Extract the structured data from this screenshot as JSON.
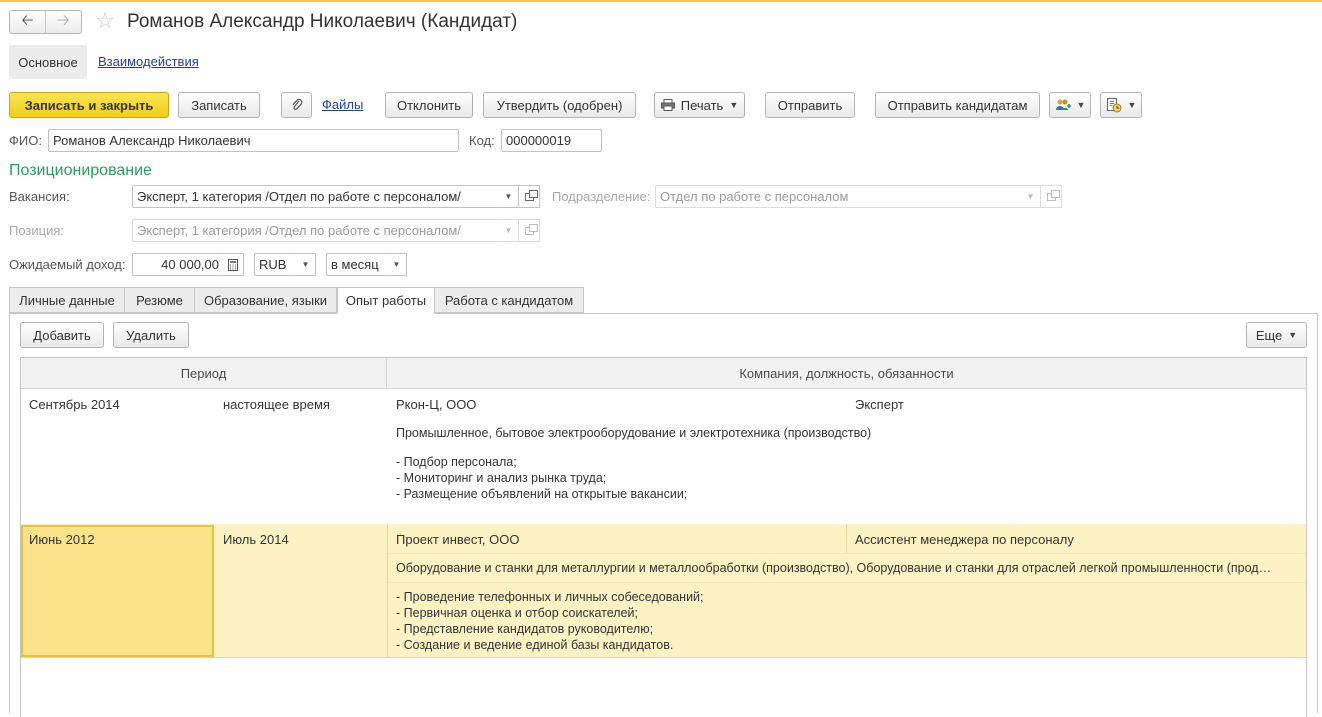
{
  "window": {
    "title": "Романов Александр Николаевич (Кандидат)",
    "back_icon": "arrow-left-icon",
    "forward_icon": "arrow-right-icon",
    "favorite_icon": "star-icon"
  },
  "sections": {
    "main": "Основное",
    "interactions": "Взаимодействия"
  },
  "toolbar": {
    "save_close": "Записать и закрыть",
    "save": "Записать",
    "files": "Файлы",
    "reject": "Отклонить",
    "approve": "Утвердить (одобрен)",
    "print": "Печать",
    "send": "Отправить",
    "send_candidates": "Отправить кандидатам"
  },
  "form": {
    "fio_label": "ФИО:",
    "fio_value": "Романов Александр Николаевич",
    "code_label": "Код:",
    "code_value": "000000019",
    "section_title": "Позиционирование",
    "vacancy_label": "Вакансия:",
    "vacancy_value": "Эксперт, 1 категория /Отдел по работе с персоналом/",
    "subdivision_label": "Подразделение:",
    "subdivision_value": "Отдел по работе с персоналом",
    "position_label": "Позиция:",
    "position_value": "Эксперт, 1 категория /Отдел по работе с персоналом/",
    "income_label": "Ожидаемый доход:",
    "income_value": "40 000,00",
    "currency_value": "RUB",
    "period_value": "в месяц"
  },
  "tabs": [
    "Личные данные",
    "Резюме",
    "Образование, языки",
    "Опыт работы",
    "Работа с кандидатом"
  ],
  "tab_active": "Опыт работы",
  "grid_toolbar": {
    "add": "Добавить",
    "delete": "Удалить",
    "more": "Еще"
  },
  "grid": {
    "columns": [
      "Период",
      "Компания, должность, обязанности"
    ],
    "rows": [
      {
        "start": "Сентябрь 2014",
        "end": "настоящее время",
        "company": "Ркон-Ц, ООО",
        "position": "Эксперт",
        "industry": "Промышленное, бытовое электрооборудование и электротехника (производство)",
        "duties": [
          "- Подбор персонала;",
          "- Мониторинг и анализ рынка труда;",
          "- Размещение объявлений на открытые вакансии;"
        ]
      },
      {
        "start": "Июнь 2012",
        "end": "Июль 2014",
        "company": "Проект инвест, ООО",
        "position": "Ассистент менеджера по персоналу",
        "industry": "Оборудование и станки для металлургии и металлообработки (производство), Оборудование и станки для отраслей легкой промышленности (прод…",
        "duties": [
          "- Проведение телефонных и личных собеседований;",
          "- Первичная оценка и отбор соискателей;",
          "- Представление кандидатов руководителю;",
          "- Создание и ведение единой базы кандидатов."
        ]
      }
    ]
  },
  "colors": {
    "accent_green": "#2a9d5b",
    "primary_button": "#f2ce17",
    "link": "#1f3ea3",
    "selected_row": "#fdf2c4"
  }
}
